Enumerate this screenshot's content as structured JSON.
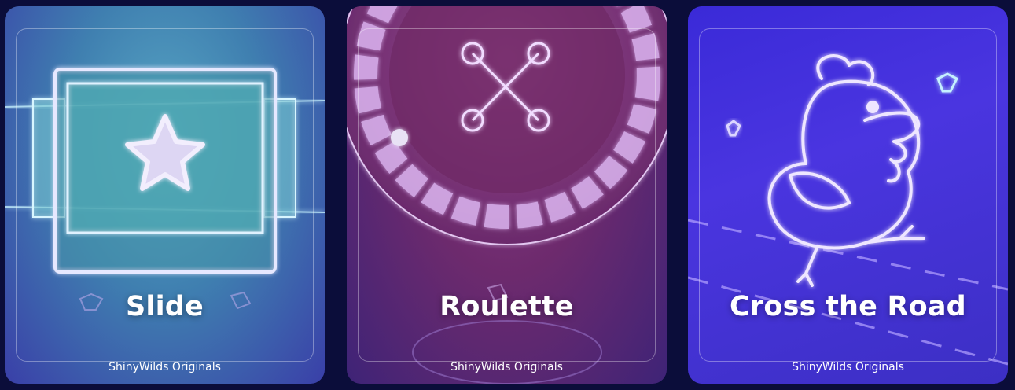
{
  "games": [
    {
      "title": "Slide",
      "provider": "ShinyWilds Originals",
      "icon": "star-icon"
    },
    {
      "title": "Roulette",
      "provider": "ShinyWilds Originals",
      "icon": "roulette-wheel-icon"
    },
    {
      "title": "Cross the Road",
      "provider": "ShinyWilds Originals",
      "icon": "chicken-icon"
    }
  ]
}
